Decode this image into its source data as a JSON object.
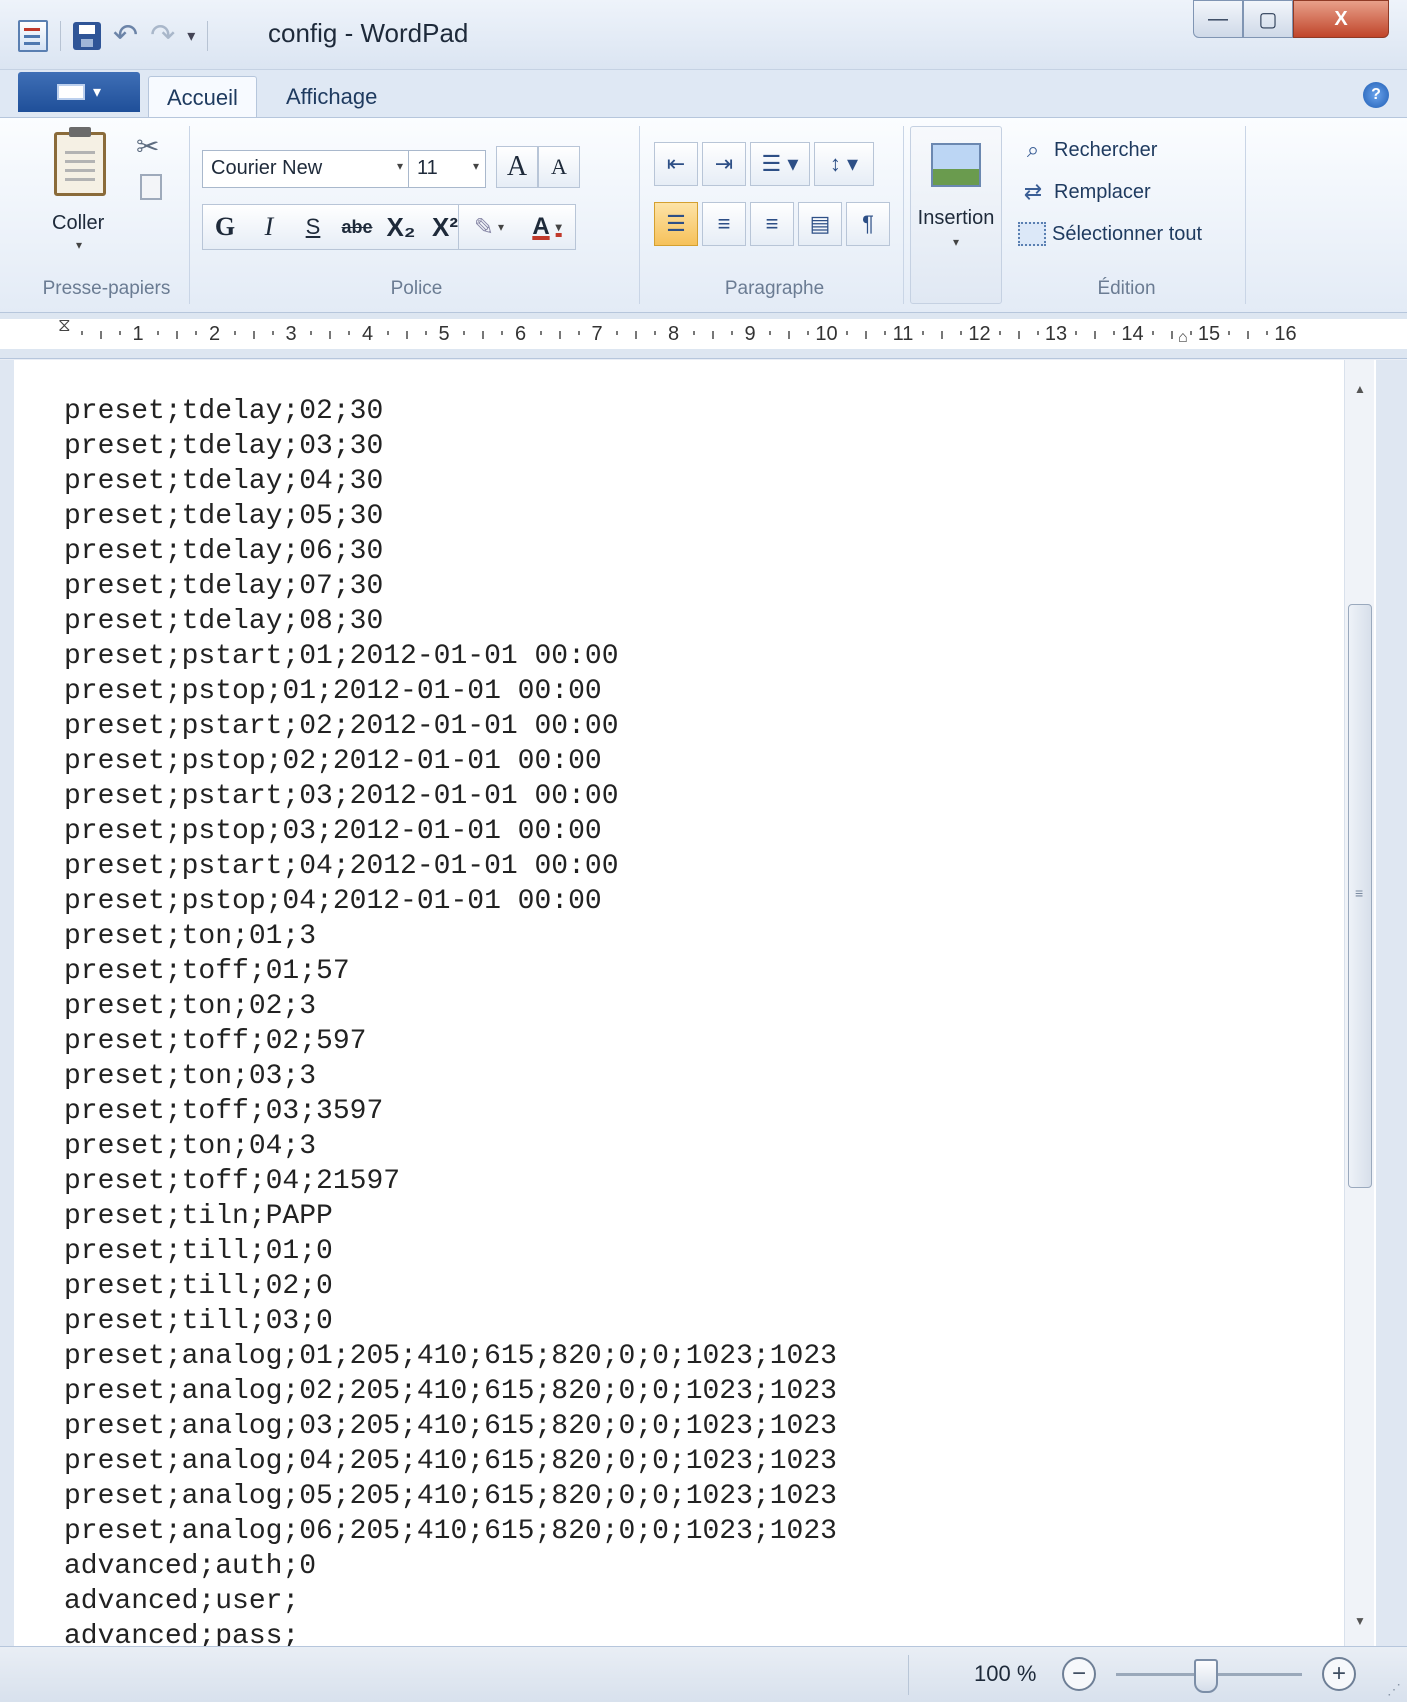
{
  "window": {
    "title": "config - WordPad",
    "min_symbol": "—",
    "max_symbol": "▢",
    "close_symbol": "X"
  },
  "ribbon": {
    "app_menu_arrow": "▾",
    "tabs": [
      {
        "label": "Accueil",
        "active": true
      },
      {
        "label": "Affichage",
        "active": false
      }
    ],
    "help_symbol": "?",
    "clipboard": {
      "paste_label": "Coller",
      "group_label": "Presse-papiers"
    },
    "font": {
      "family": "Courier New",
      "size": "11",
      "grow_label": "A",
      "shrink_label": "A",
      "bold": "G",
      "italic": "I",
      "underline": "S",
      "strikethrough": "abe",
      "subscript": "X₂",
      "superscript": "X²",
      "highlight_symbol": "✎",
      "color_label": "A",
      "group_label": "Police"
    },
    "paragraph": {
      "group_label": "Paragraphe",
      "align_left_active": true
    },
    "insert": {
      "label": "Insertion"
    },
    "editing": {
      "find": "Rechercher",
      "replace": "Remplacer",
      "select_all": "Sélectionner tout",
      "group_label": "Édition"
    }
  },
  "ruler": {
    "labels": [
      "1",
      "2",
      "3",
      "4",
      "5",
      "6",
      "7",
      "8",
      "9",
      "10",
      "11",
      "12",
      "13",
      "14",
      "15",
      "16"
    ]
  },
  "document": {
    "lines": [
      "preset;tdelay;02;30",
      "preset;tdelay;03;30",
      "preset;tdelay;04;30",
      "preset;tdelay;05;30",
      "preset;tdelay;06;30",
      "preset;tdelay;07;30",
      "preset;tdelay;08;30",
      "preset;pstart;01;2012-01-01 00:00",
      "preset;pstop;01;2012-01-01 00:00",
      "preset;pstart;02;2012-01-01 00:00",
      "preset;pstop;02;2012-01-01 00:00",
      "preset;pstart;03;2012-01-01 00:00",
      "preset;pstop;03;2012-01-01 00:00",
      "preset;pstart;04;2012-01-01 00:00",
      "preset;pstop;04;2012-01-01 00:00",
      "preset;ton;01;3",
      "preset;toff;01;57",
      "preset;ton;02;3",
      "preset;toff;02;597",
      "preset;ton;03;3",
      "preset;toff;03;3597",
      "preset;ton;04;3",
      "preset;toff;04;21597",
      "preset;tiln;PAPP",
      "preset;till;01;0",
      "preset;till;02;0",
      "preset;till;03;0",
      "preset;analog;01;205;410;615;820;0;0;1023;1023",
      "preset;analog;02;205;410;615;820;0;0;1023;1023",
      "preset;analog;03;205;410;615;820;0;0;1023;1023",
      "preset;analog;04;205;410;615;820;0;0;1023;1023",
      "preset;analog;05;205;410;615;820;0;0;1023;1023",
      "preset;analog;06;205;410;615;820;0;0;1023;1023",
      "advanced;auth;0",
      "advanced;user;",
      "advanced;pass;"
    ]
  },
  "statusbar": {
    "zoom": "100 %",
    "zoom_out_symbol": "−",
    "zoom_in_symbol": "+"
  }
}
